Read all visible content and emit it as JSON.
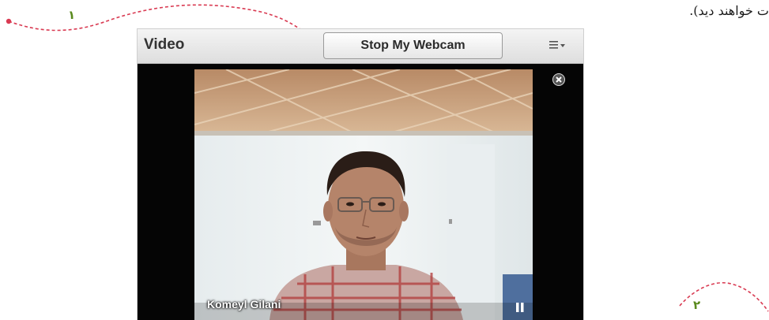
{
  "page": {
    "rtl_text": "ت خواهند دید)."
  },
  "callouts": [
    {
      "label": "۱"
    },
    {
      "label": "۲"
    }
  ],
  "pod": {
    "title": "Video",
    "webcam_button_label": "Stop My Webcam",
    "menu_icon": "pod-options-menu-icon"
  },
  "video": {
    "user_name": "Komeyl Gilani",
    "close_icon": "close-circle-icon",
    "pause_icon": "pause-icon"
  },
  "colors": {
    "callout_line": "#d93a52",
    "callout_number": "#5a8a1e",
    "header_bg": "#e8e8e8",
    "video_bg": "#050505"
  }
}
